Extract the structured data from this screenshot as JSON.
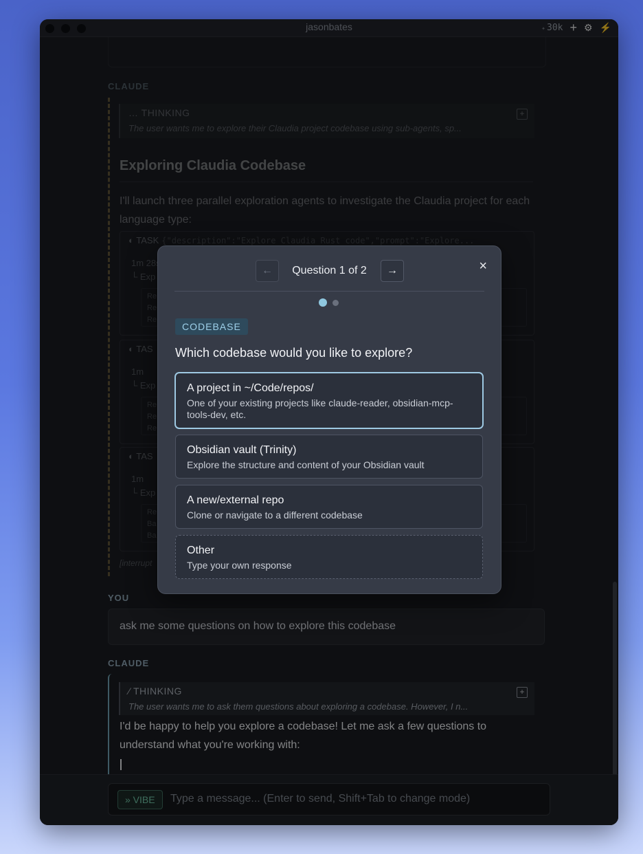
{
  "window": {
    "title": "jasonbates",
    "token_count": "30k",
    "icons": [
      "sparkle-icon",
      "plus-icon",
      "gear-icon",
      "bolt-icon"
    ]
  },
  "conversation": {
    "claude_label_1": "CLAUDE",
    "thinking_1": {
      "head": "THINKING",
      "body": "The user wants me to explore their Claudia project codebase using sub-agents, sp..."
    },
    "heading": "Exploring Claudia Codebase",
    "paragraph": "I'll launch three parallel exploration agents to investigate the Claudia project for each language type:",
    "task_1": {
      "label": "TASK",
      "args": "{\"description\":\"Explore Claudia Rust code\",\"prompt\":\"Explore...",
      "status": "1m 28s · 12 tools · Explore",
      "sub": "Exp",
      "lines": [
        "Re",
        "Re",
        "Re"
      ]
    },
    "task_2": {
      "label": "TAS",
      "status": "1m",
      "sub": "Exp",
      "lines": [
        "Re",
        "Re",
        "Re"
      ]
    },
    "task_3": {
      "label": "TAS",
      "status": "1m",
      "sub": "Exp",
      "lines": [
        "Re",
        "Ba",
        "Ba"
      ]
    },
    "interrupted": "[interrupt",
    "you_label": "YOU",
    "you_message": "ask me some questions on how to explore this codebase",
    "claude_label_2": "CLAUDE",
    "thinking_2": {
      "head": "THINKING",
      "body": "The user wants me to ask them questions about exploring a codebase. However, I n..."
    },
    "reply": "I'd be happy to help you explore a codebase! Let me ask a few questions to understand what you're working with:"
  },
  "composer": {
    "mode": "» VIBE",
    "placeholder": "Type a message... (Enter to send, Shift+Tab to change mode)"
  },
  "modal": {
    "counter": "Question 1 of 2",
    "prev_arrow": "←",
    "next_arrow": "→",
    "close": "×",
    "current_question": 1,
    "total_questions": 2,
    "tag": "CODEBASE",
    "question": "Which codebase would you like to explore?",
    "options": [
      {
        "label": "A project in ~/Code/repos/",
        "description": "One of your existing projects like claude-reader, obsidian-mcp-tools-dev, etc.",
        "selected": true
      },
      {
        "label": "Obsidian vault (Trinity)",
        "description": "Explore the structure and content of your Obsidian vault",
        "selected": false
      },
      {
        "label": "A new/external repo",
        "description": "Clone or navigate to a different codebase",
        "selected": false
      },
      {
        "label": "Other",
        "description": "Type your own response",
        "selected": false
      }
    ]
  }
}
